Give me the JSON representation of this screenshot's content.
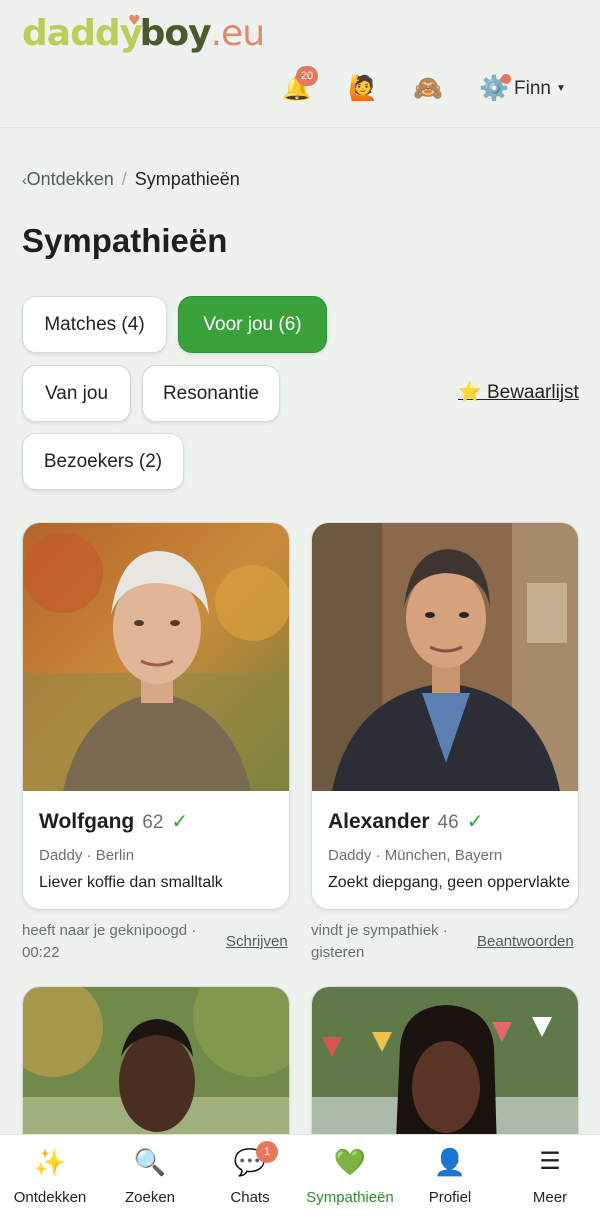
{
  "brand": {
    "part1": "daddy",
    "part2": "boy",
    "part3": ".eu"
  },
  "header": {
    "notifications_count": "20",
    "user_name": "Finn"
  },
  "breadcrumb": {
    "back_label": "Ontdekken",
    "current": "Sympathieën"
  },
  "page_title": "Sympathieën",
  "filters": [
    {
      "label": "Matches (4)",
      "active": false
    },
    {
      "label": "Voor jou (6)",
      "active": true
    },
    {
      "label": "Van jou",
      "active": false
    },
    {
      "label": "Resonantie",
      "active": false
    },
    {
      "label": "Bezoekers (2)",
      "active": false
    }
  ],
  "saved_list": {
    "icon": "⭐",
    "label": "Bewaarlijst"
  },
  "cards": [
    {
      "name": "Wolfgang",
      "age": "62",
      "verified": "✓",
      "meta": "Daddy · Berlin",
      "tagline": "Liever koffie dan smalltalk",
      "activity_line1": "heeft naar je geknipoogd ·",
      "activity_line2": "00:22",
      "action": "Schrijven"
    },
    {
      "name": "Alexander",
      "age": "46",
      "verified": "✓",
      "meta": "Daddy · München, Bayern",
      "tagline": "Zoekt diepgang, geen oppervlakte",
      "activity_line1": "vindt je sympathiek ·",
      "activity_line2": "gisteren",
      "action": "Beantwoorden"
    }
  ],
  "bottom_nav": [
    {
      "label": "Ontdekken",
      "icon": "sparkles-icon"
    },
    {
      "label": "Zoeken",
      "icon": "search-icon"
    },
    {
      "label": "Chats",
      "icon": "chat-icon",
      "badge": "1"
    },
    {
      "label": "Sympathieën",
      "icon": "heart-icon",
      "active": true
    },
    {
      "label": "Profiel",
      "icon": "profile-icon"
    },
    {
      "label": "Meer",
      "icon": "menu-icon"
    }
  ],
  "colors": {
    "accent": "#3aa23a",
    "badge": "#e8765c",
    "background": "#eef2ef"
  }
}
